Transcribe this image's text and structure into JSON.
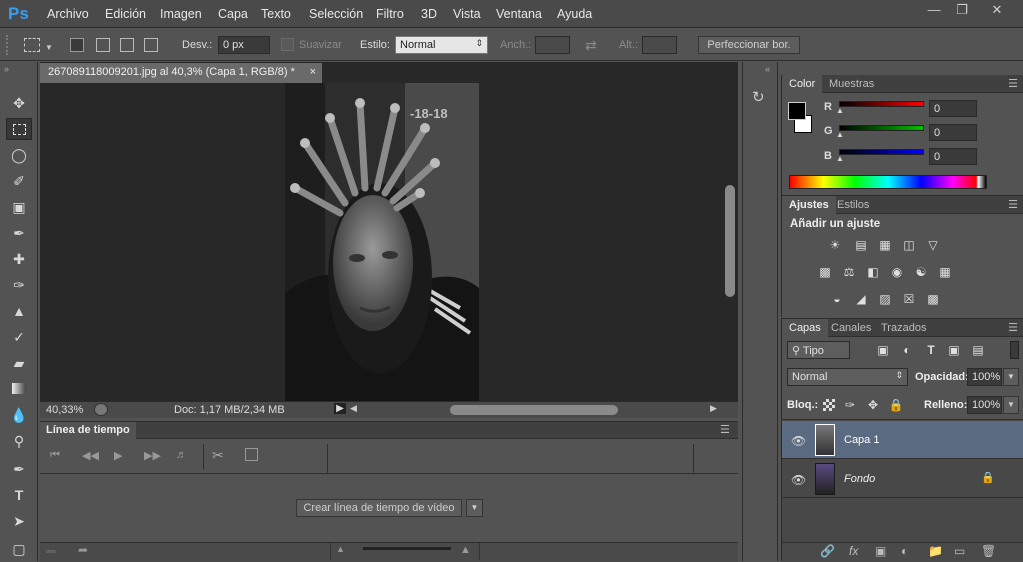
{
  "app": {
    "logo": "Ps"
  },
  "menu": [
    "Archivo",
    "Edición",
    "Imagen",
    "Capa",
    "Texto",
    "Selección",
    "Filtro",
    "3D",
    "Vista",
    "Ventana",
    "Ayuda"
  ],
  "options": {
    "desv_label": "Desv.:",
    "desv_value": "0 px",
    "suavizar_label": "Suavizar",
    "estilo_label": "Estilo:",
    "estilo_value": "Normal",
    "anch_label": "Anch.:",
    "alt_label": "Alt.:",
    "refine_button": "Perfeccionar bor."
  },
  "document": {
    "tab_title": "267089118009201.jpg al 40,3% (Capa 1, RGB/8) *",
    "close": "×",
    "zoom": "40,33%",
    "doc_info": "Doc: 1,17 MB/2,34 MB",
    "watermark": "-18-18"
  },
  "timeline": {
    "tab": "Línea de tiempo",
    "create_button": "Crear línea de tiempo de vídeo"
  },
  "color_panel": {
    "tabs": [
      "Color",
      "Muestras"
    ],
    "r_label": "R",
    "g_label": "G",
    "b_label": "B",
    "r_value": "0",
    "g_value": "0",
    "b_value": "0"
  },
  "adjustments_panel": {
    "tabs": [
      "Ajustes",
      "Estilos"
    ],
    "heading": "Añadir un ajuste"
  },
  "layers_panel": {
    "tabs": [
      "Capas",
      "Canales",
      "Trazados"
    ],
    "filter_kind": "Tipo",
    "blend_mode": "Normal",
    "opacity_label": "Opacidad:",
    "opacity_value": "100%",
    "lock_label": "Bloq.:",
    "fill_label": "Relleno:",
    "fill_value": "100%",
    "layers": [
      {
        "name": "Capa 1",
        "selected": true
      },
      {
        "name": "Fondo",
        "selected": false
      }
    ]
  }
}
